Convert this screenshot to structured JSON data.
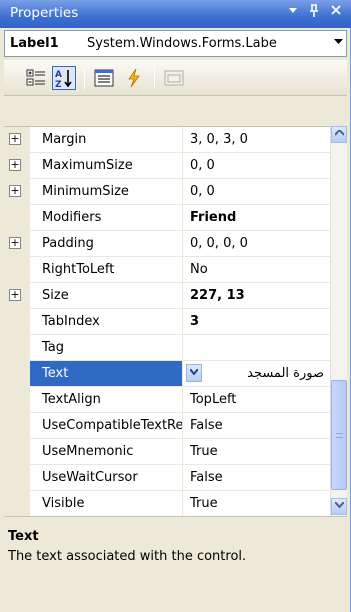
{
  "window": {
    "title": "Properties",
    "pin_glyph": "↓",
    "pin_glyph2": "\u0001",
    "close_glyph": "✕"
  },
  "object_selector": {
    "name": "Label1",
    "type": "System.Windows.Forms.Labe",
    "dropdown_glyph": "▼"
  },
  "toolbar": {
    "buttons": [
      {
        "name": "categorized",
        "icon": "categorized-icon",
        "active": false
      },
      {
        "name": "alphabetical",
        "icon": "alphabetical-sort-icon",
        "active": true
      },
      {
        "name": "properties",
        "icon": "properties-icon",
        "active": false
      },
      {
        "name": "events",
        "icon": "lightning-bolt-icon",
        "active": false
      },
      {
        "name": "property-pages",
        "icon": "property-pages-icon",
        "active": false
      }
    ]
  },
  "grid": {
    "rows": [
      {
        "name": "Margin",
        "value": "3, 0, 3, 0",
        "expandable": true,
        "bold": false
      },
      {
        "name": "MaximumSize",
        "value": "0, 0",
        "expandable": true,
        "bold": false
      },
      {
        "name": "MinimumSize",
        "value": "0, 0",
        "expandable": true,
        "bold": false
      },
      {
        "name": "Modifiers",
        "value": "Friend",
        "expandable": false,
        "bold": true
      },
      {
        "name": "Padding",
        "value": "0, 0, 0, 0",
        "expandable": true,
        "bold": false
      },
      {
        "name": "RightToLeft",
        "value": "No",
        "expandable": false,
        "bold": false
      },
      {
        "name": "Size",
        "value": "227, 13",
        "expandable": true,
        "bold": true
      },
      {
        "name": "TabIndex",
        "value": "3",
        "expandable": false,
        "bold": true
      },
      {
        "name": "Tag",
        "value": "",
        "expandable": false,
        "bold": false
      },
      {
        "name": "Text",
        "value": "صورة المسجد",
        "expandable": false,
        "bold": false,
        "selected": true
      },
      {
        "name": "TextAlign",
        "value": "TopLeft",
        "expandable": false,
        "bold": false
      },
      {
        "name": "UseCompatibleTextRendering",
        "value": "False",
        "expandable": false,
        "bold": false
      },
      {
        "name": "UseMnemonic",
        "value": "True",
        "expandable": false,
        "bold": false
      },
      {
        "name": "UseWaitCursor",
        "value": "False",
        "expandable": false,
        "bold": false
      },
      {
        "name": "Visible",
        "value": "True",
        "expandable": false,
        "bold": false
      }
    ],
    "expand_glyph": "+"
  },
  "description": {
    "title": "Text",
    "text": "The text associated with the control."
  },
  "colors": {
    "titlebar": "#3c6fd1",
    "selection": "#316ac5",
    "panel": "#ece9d8"
  }
}
